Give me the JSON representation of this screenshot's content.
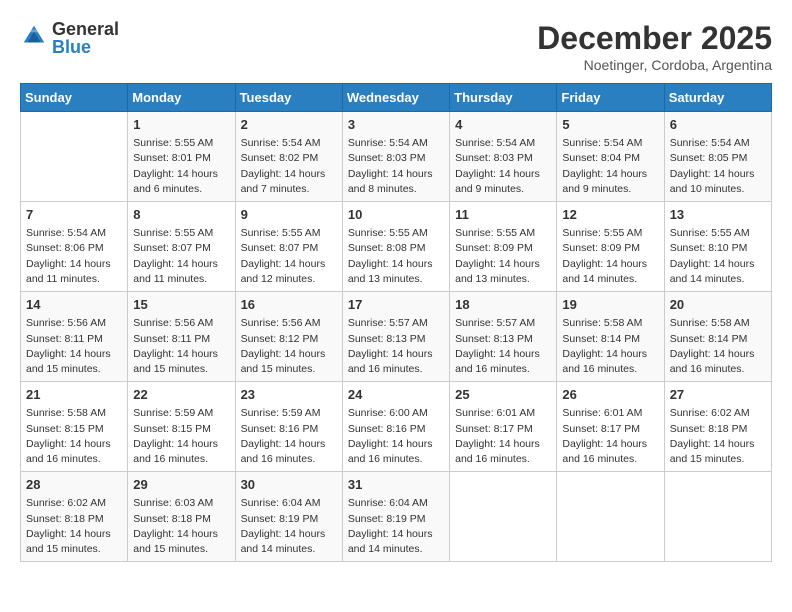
{
  "logo": {
    "general": "General",
    "blue": "Blue"
  },
  "title": "December 2025",
  "location": "Noetinger, Cordoba, Argentina",
  "days_header": [
    "Sunday",
    "Monday",
    "Tuesday",
    "Wednesday",
    "Thursday",
    "Friday",
    "Saturday"
  ],
  "weeks": [
    [
      {
        "day": "",
        "sunrise": "",
        "sunset": "",
        "daylight": ""
      },
      {
        "day": "1",
        "sunrise": "Sunrise: 5:55 AM",
        "sunset": "Sunset: 8:01 PM",
        "daylight": "Daylight: 14 hours and 6 minutes."
      },
      {
        "day": "2",
        "sunrise": "Sunrise: 5:54 AM",
        "sunset": "Sunset: 8:02 PM",
        "daylight": "Daylight: 14 hours and 7 minutes."
      },
      {
        "day": "3",
        "sunrise": "Sunrise: 5:54 AM",
        "sunset": "Sunset: 8:03 PM",
        "daylight": "Daylight: 14 hours and 8 minutes."
      },
      {
        "day": "4",
        "sunrise": "Sunrise: 5:54 AM",
        "sunset": "Sunset: 8:03 PM",
        "daylight": "Daylight: 14 hours and 9 minutes."
      },
      {
        "day": "5",
        "sunrise": "Sunrise: 5:54 AM",
        "sunset": "Sunset: 8:04 PM",
        "daylight": "Daylight: 14 hours and 9 minutes."
      },
      {
        "day": "6",
        "sunrise": "Sunrise: 5:54 AM",
        "sunset": "Sunset: 8:05 PM",
        "daylight": "Daylight: 14 hours and 10 minutes."
      }
    ],
    [
      {
        "day": "7",
        "sunrise": "Sunrise: 5:54 AM",
        "sunset": "Sunset: 8:06 PM",
        "daylight": "Daylight: 14 hours and 11 minutes."
      },
      {
        "day": "8",
        "sunrise": "Sunrise: 5:55 AM",
        "sunset": "Sunset: 8:07 PM",
        "daylight": "Daylight: 14 hours and 11 minutes."
      },
      {
        "day": "9",
        "sunrise": "Sunrise: 5:55 AM",
        "sunset": "Sunset: 8:07 PM",
        "daylight": "Daylight: 14 hours and 12 minutes."
      },
      {
        "day": "10",
        "sunrise": "Sunrise: 5:55 AM",
        "sunset": "Sunset: 8:08 PM",
        "daylight": "Daylight: 14 hours and 13 minutes."
      },
      {
        "day": "11",
        "sunrise": "Sunrise: 5:55 AM",
        "sunset": "Sunset: 8:09 PM",
        "daylight": "Daylight: 14 hours and 13 minutes."
      },
      {
        "day": "12",
        "sunrise": "Sunrise: 5:55 AM",
        "sunset": "Sunset: 8:09 PM",
        "daylight": "Daylight: 14 hours and 14 minutes."
      },
      {
        "day": "13",
        "sunrise": "Sunrise: 5:55 AM",
        "sunset": "Sunset: 8:10 PM",
        "daylight": "Daylight: 14 hours and 14 minutes."
      }
    ],
    [
      {
        "day": "14",
        "sunrise": "Sunrise: 5:56 AM",
        "sunset": "Sunset: 8:11 PM",
        "daylight": "Daylight: 14 hours and 15 minutes."
      },
      {
        "day": "15",
        "sunrise": "Sunrise: 5:56 AM",
        "sunset": "Sunset: 8:11 PM",
        "daylight": "Daylight: 14 hours and 15 minutes."
      },
      {
        "day": "16",
        "sunrise": "Sunrise: 5:56 AM",
        "sunset": "Sunset: 8:12 PM",
        "daylight": "Daylight: 14 hours and 15 minutes."
      },
      {
        "day": "17",
        "sunrise": "Sunrise: 5:57 AM",
        "sunset": "Sunset: 8:13 PM",
        "daylight": "Daylight: 14 hours and 16 minutes."
      },
      {
        "day": "18",
        "sunrise": "Sunrise: 5:57 AM",
        "sunset": "Sunset: 8:13 PM",
        "daylight": "Daylight: 14 hours and 16 minutes."
      },
      {
        "day": "19",
        "sunrise": "Sunrise: 5:58 AM",
        "sunset": "Sunset: 8:14 PM",
        "daylight": "Daylight: 14 hours and 16 minutes."
      },
      {
        "day": "20",
        "sunrise": "Sunrise: 5:58 AM",
        "sunset": "Sunset: 8:14 PM",
        "daylight": "Daylight: 14 hours and 16 minutes."
      }
    ],
    [
      {
        "day": "21",
        "sunrise": "Sunrise: 5:58 AM",
        "sunset": "Sunset: 8:15 PM",
        "daylight": "Daylight: 14 hours and 16 minutes."
      },
      {
        "day": "22",
        "sunrise": "Sunrise: 5:59 AM",
        "sunset": "Sunset: 8:15 PM",
        "daylight": "Daylight: 14 hours and 16 minutes."
      },
      {
        "day": "23",
        "sunrise": "Sunrise: 5:59 AM",
        "sunset": "Sunset: 8:16 PM",
        "daylight": "Daylight: 14 hours and 16 minutes."
      },
      {
        "day": "24",
        "sunrise": "Sunrise: 6:00 AM",
        "sunset": "Sunset: 8:16 PM",
        "daylight": "Daylight: 14 hours and 16 minutes."
      },
      {
        "day": "25",
        "sunrise": "Sunrise: 6:01 AM",
        "sunset": "Sunset: 8:17 PM",
        "daylight": "Daylight: 14 hours and 16 minutes."
      },
      {
        "day": "26",
        "sunrise": "Sunrise: 6:01 AM",
        "sunset": "Sunset: 8:17 PM",
        "daylight": "Daylight: 14 hours and 16 minutes."
      },
      {
        "day": "27",
        "sunrise": "Sunrise: 6:02 AM",
        "sunset": "Sunset: 8:18 PM",
        "daylight": "Daylight: 14 hours and 15 minutes."
      }
    ],
    [
      {
        "day": "28",
        "sunrise": "Sunrise: 6:02 AM",
        "sunset": "Sunset: 8:18 PM",
        "daylight": "Daylight: 14 hours and 15 minutes."
      },
      {
        "day": "29",
        "sunrise": "Sunrise: 6:03 AM",
        "sunset": "Sunset: 8:18 PM",
        "daylight": "Daylight: 14 hours and 15 minutes."
      },
      {
        "day": "30",
        "sunrise": "Sunrise: 6:04 AM",
        "sunset": "Sunset: 8:19 PM",
        "daylight": "Daylight: 14 hours and 14 minutes."
      },
      {
        "day": "31",
        "sunrise": "Sunrise: 6:04 AM",
        "sunset": "Sunset: 8:19 PM",
        "daylight": "Daylight: 14 hours and 14 minutes."
      },
      {
        "day": "",
        "sunrise": "",
        "sunset": "",
        "daylight": ""
      },
      {
        "day": "",
        "sunrise": "",
        "sunset": "",
        "daylight": ""
      },
      {
        "day": "",
        "sunrise": "",
        "sunset": "",
        "daylight": ""
      }
    ]
  ]
}
